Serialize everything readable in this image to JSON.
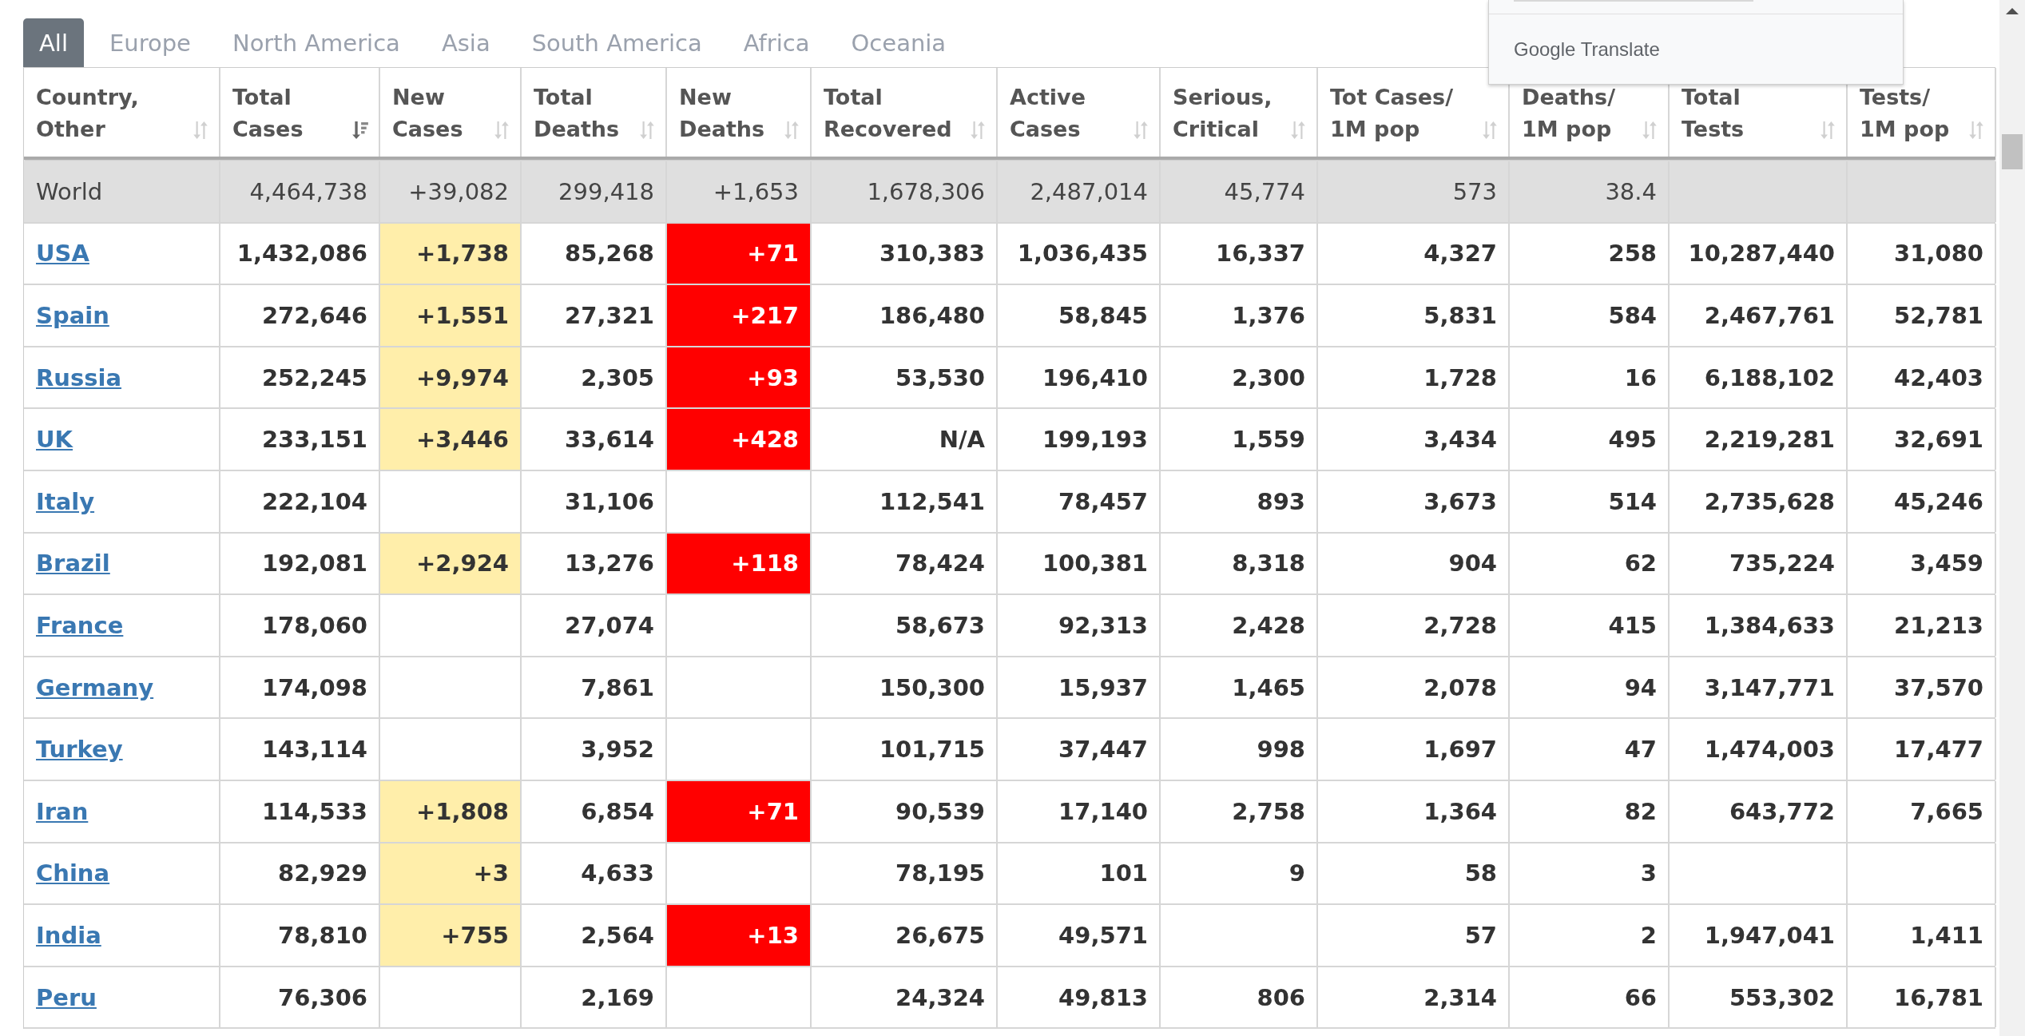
{
  "tabs": [
    {
      "label": "All",
      "selected": true
    },
    {
      "label": "Europe",
      "selected": false
    },
    {
      "label": "North America",
      "selected": false
    },
    {
      "label": "Asia",
      "selected": false
    },
    {
      "label": "South America",
      "selected": false
    },
    {
      "label": "Africa",
      "selected": false
    },
    {
      "label": "Oceania",
      "selected": false
    }
  ],
  "translate_popup": {
    "brand": "Google Translate"
  },
  "table": {
    "columns": [
      {
        "lines": [
          "Country,",
          "Other"
        ],
        "sorted": false
      },
      {
        "lines": [
          "Total",
          "Cases"
        ],
        "sorted": true
      },
      {
        "lines": [
          "New",
          "Cases"
        ],
        "sorted": false
      },
      {
        "lines": [
          "Total",
          "Deaths"
        ],
        "sorted": false
      },
      {
        "lines": [
          "New",
          "Deaths"
        ],
        "sorted": false
      },
      {
        "lines": [
          "Total",
          "Recovered"
        ],
        "sorted": false
      },
      {
        "lines": [
          "Active",
          "Cases"
        ],
        "sorted": false
      },
      {
        "lines": [
          "Serious,",
          "Critical"
        ],
        "sorted": false
      },
      {
        "lines": [
          "Tot Cases/",
          "1M pop"
        ],
        "sorted": false
      },
      {
        "lines": [
          "Deaths/",
          "1M pop"
        ],
        "sorted": false
      },
      {
        "lines": [
          "Total",
          "Tests"
        ],
        "sorted": false
      },
      {
        "lines": [
          "Tests/",
          "1M pop"
        ],
        "sorted": false
      }
    ],
    "rows": [
      {
        "kind": "total",
        "cells": [
          "World",
          "4,464,738",
          "+39,082",
          "299,418",
          "+1,653",
          "1,678,306",
          "2,487,014",
          "45,774",
          "573",
          "38.4",
          "",
          ""
        ]
      },
      {
        "kind": "country",
        "cells": [
          "USA",
          "1,432,086",
          "+1,738",
          "85,268",
          "+71",
          "310,383",
          "1,036,435",
          "16,337",
          "4,327",
          "258",
          "10,287,440",
          "31,080"
        ]
      },
      {
        "kind": "country",
        "cells": [
          "Spain",
          "272,646",
          "+1,551",
          "27,321",
          "+217",
          "186,480",
          "58,845",
          "1,376",
          "5,831",
          "584",
          "2,467,761",
          "52,781"
        ]
      },
      {
        "kind": "country",
        "cells": [
          "Russia",
          "252,245",
          "+9,974",
          "2,305",
          "+93",
          "53,530",
          "196,410",
          "2,300",
          "1,728",
          "16",
          "6,188,102",
          "42,403"
        ]
      },
      {
        "kind": "country",
        "cells": [
          "UK",
          "233,151",
          "+3,446",
          "33,614",
          "+428",
          "N/A",
          "199,193",
          "1,559",
          "3,434",
          "495",
          "2,219,281",
          "32,691"
        ]
      },
      {
        "kind": "country",
        "cells": [
          "Italy",
          "222,104",
          "",
          "31,106",
          "",
          "112,541",
          "78,457",
          "893",
          "3,673",
          "514",
          "2,735,628",
          "45,246"
        ]
      },
      {
        "kind": "country",
        "cells": [
          "Brazil",
          "192,081",
          "+2,924",
          "13,276",
          "+118",
          "78,424",
          "100,381",
          "8,318",
          "904",
          "62",
          "735,224",
          "3,459"
        ]
      },
      {
        "kind": "country",
        "cells": [
          "France",
          "178,060",
          "",
          "27,074",
          "",
          "58,673",
          "92,313",
          "2,428",
          "2,728",
          "415",
          "1,384,633",
          "21,213"
        ]
      },
      {
        "kind": "country",
        "cells": [
          "Germany",
          "174,098",
          "",
          "7,861",
          "",
          "150,300",
          "15,937",
          "1,465",
          "2,078",
          "94",
          "3,147,771",
          "37,570"
        ]
      },
      {
        "kind": "country",
        "cells": [
          "Turkey",
          "143,114",
          "",
          "3,952",
          "",
          "101,715",
          "37,447",
          "998",
          "1,697",
          "47",
          "1,474,003",
          "17,477"
        ]
      },
      {
        "kind": "country",
        "cells": [
          "Iran",
          "114,533",
          "+1,808",
          "6,854",
          "+71",
          "90,539",
          "17,140",
          "2,758",
          "1,364",
          "82",
          "643,772",
          "7,665"
        ]
      },
      {
        "kind": "country",
        "cells": [
          "China",
          "82,929",
          "+3",
          "4,633",
          "",
          "78,195",
          "101",
          "9",
          "58",
          "3",
          "",
          ""
        ]
      },
      {
        "kind": "country",
        "cells": [
          "India",
          "78,810",
          "+755",
          "2,564",
          "+13",
          "26,675",
          "49,571",
          "",
          "57",
          "2",
          "1,947,041",
          "1,411"
        ]
      },
      {
        "kind": "country",
        "cells": [
          "Peru",
          "76,306",
          "",
          "2,169",
          "",
          "24,324",
          "49,813",
          "806",
          "2,314",
          "66",
          "553,302",
          "16,781"
        ]
      }
    ]
  }
}
